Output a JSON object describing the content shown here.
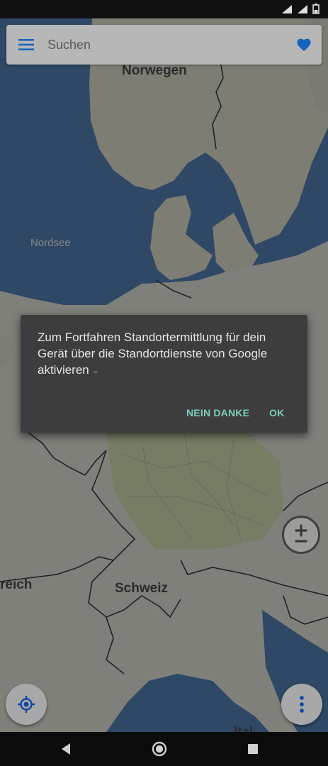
{
  "search": {
    "placeholder": "Suchen"
  },
  "map": {
    "labels": {
      "norwegen": "Norwegen",
      "nordsee": "Nordsee",
      "schweiz": "Schweiz",
      "reich": "reich",
      "ital": "Ital"
    }
  },
  "dialog": {
    "message": "Zum Fortfahren Standortermittlung für dein Gerät über die Standortdienste von Google aktivieren",
    "expand_glyph": "⌄",
    "no_label": "NEIN DANKE",
    "ok_label": "OK"
  },
  "icons": {
    "menu": "menu-icon",
    "favorite": "heart-icon",
    "zoom": "zoom-plus-minus-icon",
    "location": "my-location-icon",
    "more": "more-vert-icon",
    "back": "back-icon",
    "home": "home-icon",
    "recents": "recents-icon"
  },
  "colors": {
    "accent": "#1565c0",
    "dialog_button": "#7ccdc0"
  }
}
